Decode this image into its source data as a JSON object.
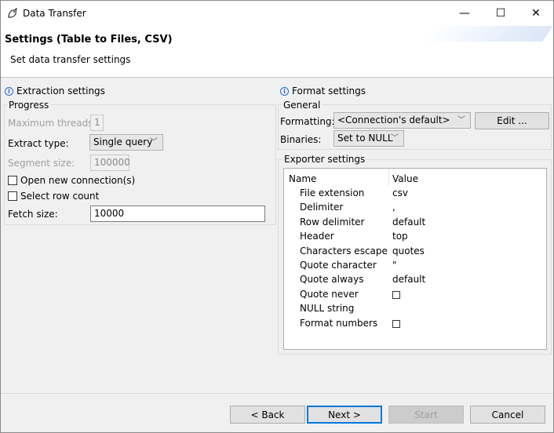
{
  "window": {
    "title": "Data Transfer",
    "minimize": "—",
    "maximize": "☐",
    "close": "✕"
  },
  "header": {
    "title": "Settings (Table to Files, CSV)",
    "subtitle": "Set data transfer settings"
  },
  "extraction": {
    "section_title": "Extraction settings",
    "progress_label": "Progress",
    "max_threads_label": "Maximum threads:",
    "max_threads_value": "1",
    "extract_type_label": "Extract type:",
    "extract_type_value": "Single query",
    "segment_size_label": "Segment size:",
    "segment_size_value": "100000",
    "open_new_connections_label": "Open new connection(s)",
    "select_row_count_label": "Select row count",
    "fetch_size_label": "Fetch size:",
    "fetch_size_value": "10000"
  },
  "format": {
    "section_title": "Format settings",
    "general_label": "General",
    "formatting_label": "Formatting:",
    "formatting_value": "<Connection's default>",
    "edit_button": "Edit ...",
    "binaries_label": "Binaries:",
    "binaries_value": "Set to NULL"
  },
  "exporter": {
    "label": "Exporter settings",
    "col_name": "Name",
    "col_value": "Value",
    "rows": [
      {
        "name": "File extension",
        "value": "csv"
      },
      {
        "name": "Delimiter",
        "value": ","
      },
      {
        "name": "Row delimiter",
        "value": "default"
      },
      {
        "name": "Header",
        "value": "top"
      },
      {
        "name": "Characters escape",
        "value": "quotes"
      },
      {
        "name": "Quote character",
        "value": "\""
      },
      {
        "name": "Quote always",
        "value": "default"
      },
      {
        "name": "Quote never",
        "value": ""
      },
      {
        "name": "NULL string",
        "value": ""
      },
      {
        "name": "Format numbers",
        "value": ""
      }
    ]
  },
  "footer": {
    "back": "< Back",
    "next": "Next >",
    "start": "Start",
    "cancel": "Cancel"
  }
}
